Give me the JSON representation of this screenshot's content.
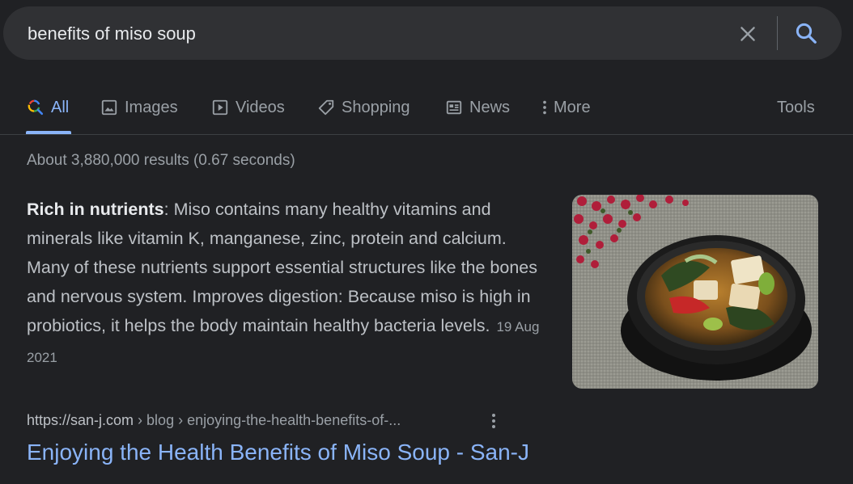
{
  "search": {
    "query": "benefits of miso soup"
  },
  "tabs": [
    {
      "label": "All",
      "icon": "google-search-icon",
      "active": true
    },
    {
      "label": "Images",
      "icon": "image-icon"
    },
    {
      "label": "Videos",
      "icon": "play-icon"
    },
    {
      "label": "Shopping",
      "icon": "tag-icon"
    },
    {
      "label": "News",
      "icon": "newspaper-icon"
    },
    {
      "label": "More",
      "icon": "more-vert-icon"
    }
  ],
  "tools_label": "Tools",
  "result_stats": "About 3,880,000 results (0.67 seconds)",
  "featured_snippet": {
    "bold_lead": "Rich in nutrients",
    "text": ": Miso contains many healthy vitamins and minerals like vitamin K, manganese, zinc, protein and calcium. Many of these nutrients support essential structures like the bones and nervous system. Improves digestion: Because miso is high in probiotics, it helps the body maintain healthy bacteria levels.",
    "date": "19 Aug 2021",
    "image": "miso-soup-bowl-photo"
  },
  "result": {
    "domain": "https://san-j.com",
    "breadcrumbs": " › blog › enjoying-the-health-benefits-of-...",
    "title": "Enjoying the Health Benefits of Miso Soup - San-J"
  },
  "colors": {
    "background": "#202124",
    "search_bar": "#303134",
    "accent": "#8ab4f8",
    "text": "#bdc1c6",
    "muted": "#9aa0a6"
  }
}
